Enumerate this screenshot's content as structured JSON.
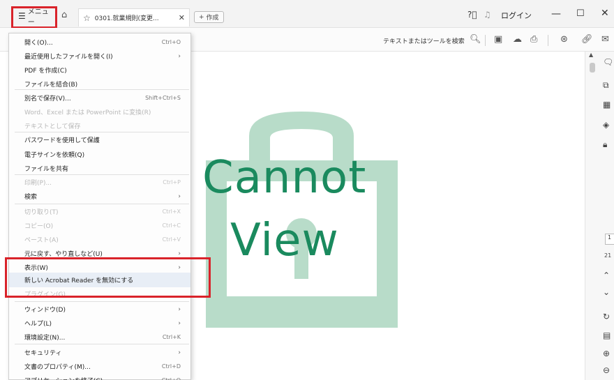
{
  "titlebar": {
    "menu_label": "メニュー",
    "tab_title": "0301.就業規則(変更...",
    "new_tab_label": "作成",
    "login_label": "ログイン"
  },
  "toolbar": {
    "search_label": "テキストまたはツールを検索"
  },
  "document": {
    "watermark_line1": "Cannot",
    "watermark_line2": "View",
    "page_current": "1",
    "page_total": "21"
  },
  "menu": {
    "items": [
      {
        "label": "開く(O)...",
        "shortcut": "Ctrl+O",
        "arrow": "",
        "disabled": false
      },
      {
        "label": "最近使用したファイルを開く(I)",
        "shortcut": "",
        "arrow": "›",
        "disabled": false
      },
      {
        "label": "PDF を作成(C)",
        "shortcut": "",
        "arrow": "",
        "disabled": false
      },
      {
        "label": "ファイルを結合(B)",
        "shortcut": "",
        "arrow": "",
        "disabled": false
      },
      {
        "label": "別名で保存(V)...",
        "shortcut": "Shift+Ctrl+S",
        "arrow": "",
        "disabled": false
      },
      {
        "label": "Word、Excel または PowerPoint に変換(R)",
        "shortcut": "",
        "arrow": "",
        "disabled": true
      },
      {
        "label": "テキストとして保存",
        "shortcut": "",
        "arrow": "",
        "disabled": true
      },
      {
        "label": "パスワードを使用して保護",
        "shortcut": "",
        "arrow": "",
        "disabled": false
      },
      {
        "label": "電子サインを依頼(Q)",
        "shortcut": "",
        "arrow": "",
        "disabled": false
      },
      {
        "label": "ファイルを共有",
        "shortcut": "",
        "arrow": "",
        "disabled": false
      },
      {
        "label": "印刷(P)...",
        "shortcut": "Ctrl+P",
        "arrow": "",
        "disabled": true
      },
      {
        "label": "検索",
        "shortcut": "",
        "arrow": "›",
        "disabled": false
      },
      {
        "label": "切り取り(T)",
        "shortcut": "Ctrl+X",
        "arrow": "",
        "disabled": true
      },
      {
        "label": "コピー(O)",
        "shortcut": "Ctrl+C",
        "arrow": "",
        "disabled": true
      },
      {
        "label": "ペースト(A)",
        "shortcut": "Ctrl+V",
        "arrow": "",
        "disabled": true
      },
      {
        "label": "元に戻す、やり直しなど(U)",
        "shortcut": "",
        "arrow": "›",
        "disabled": false
      },
      {
        "label": "表示(W)",
        "shortcut": "",
        "arrow": "›",
        "disabled": false
      },
      {
        "label": "新しい Acrobat Reader を無効にする",
        "shortcut": "",
        "arrow": "",
        "disabled": false
      },
      {
        "label": "プラグイン(G)",
        "shortcut": "",
        "arrow": "",
        "disabled": true
      },
      {
        "label": "ウィンドウ(D)",
        "shortcut": "",
        "arrow": "›",
        "disabled": false
      },
      {
        "label": "ヘルプ(L)",
        "shortcut": "",
        "arrow": "›",
        "disabled": false
      },
      {
        "label": "環境設定(N)...",
        "shortcut": "Ctrl+K",
        "arrow": "",
        "disabled": false
      },
      {
        "label": "セキュリティ",
        "shortcut": "",
        "arrow": "›",
        "disabled": false
      },
      {
        "label": "文書のプロパティ(M)...",
        "shortcut": "Ctrl+D",
        "arrow": "",
        "disabled": false
      },
      {
        "label": "アプリケーションを終了(C)",
        "shortcut": "Ctrl+Q",
        "arrow": "",
        "disabled": false
      }
    ]
  },
  "colors": {
    "highlight_red": "#d9232a",
    "watermark_green": "#1a8a5e",
    "lock_green": "#b8dcc9"
  },
  "icons": {
    "menu": "hamburger-icon",
    "home": "home-icon",
    "favorite": "star-icon",
    "close_tab": "close-icon",
    "add_tab": "plus-icon",
    "help": "help-icon",
    "notification": "bell-icon",
    "minimize": "minimize-icon",
    "maximize": "maximize-icon",
    "close_window": "close-icon",
    "search": "search-icon"
  }
}
